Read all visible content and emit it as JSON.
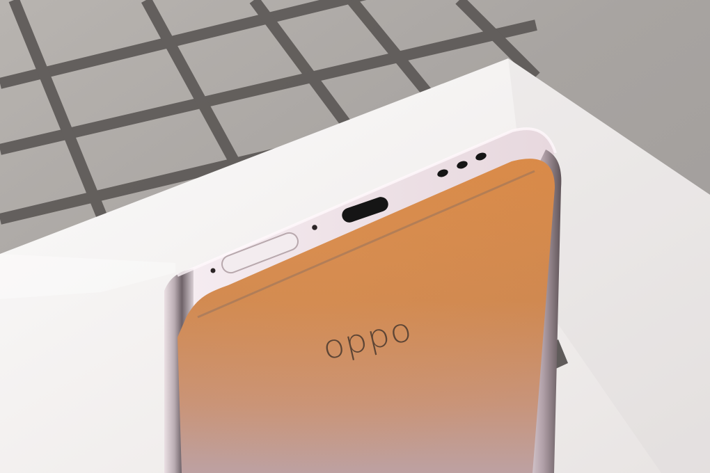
{
  "scene": {
    "subject": "smartphone",
    "brand_logo_text": "oppo",
    "colors": {
      "background_gray": "#a9a6a3",
      "grid_line": "#5f5b59",
      "white_box": "#f4f2f1",
      "back_top": "#d78a4b",
      "back_mid": "#cf8850",
      "back_bottom": "#c39c97",
      "frame_light": "#efe5ea",
      "frame_mid": "#d4c3c9",
      "frame_dark": "#7a6d73",
      "port_black": "#151515",
      "logo_dark": "#5d4535"
    }
  }
}
